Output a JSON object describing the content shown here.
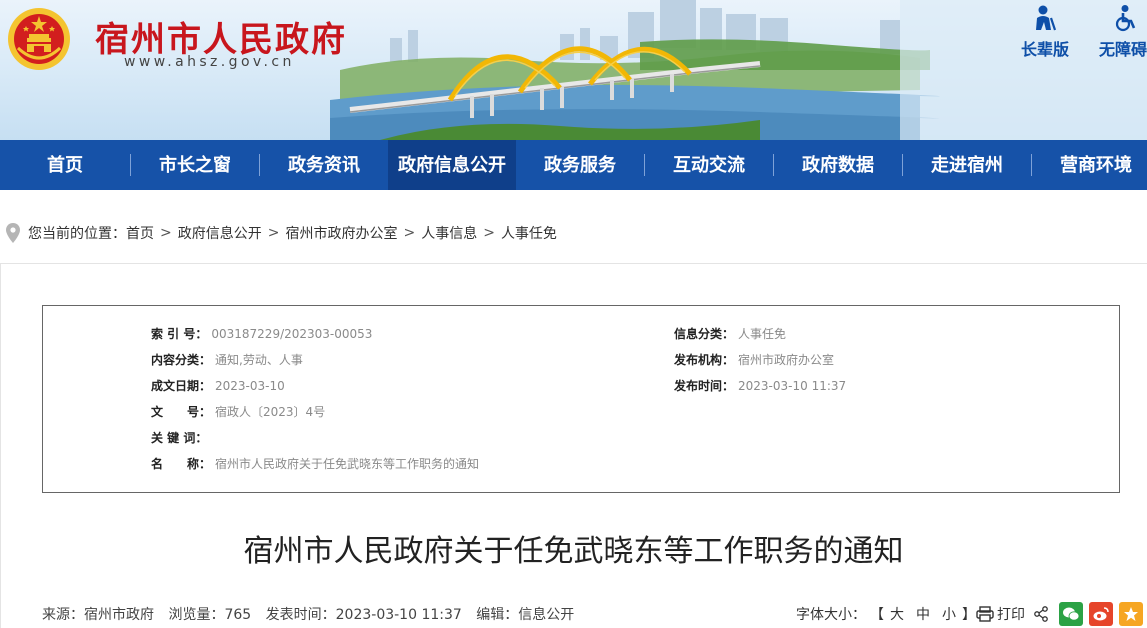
{
  "header": {
    "site_title": "宿州市人民政府",
    "site_url": "www.ahsz.gov.cn",
    "elder_mode": "长辈版",
    "accessibility": "无障碍"
  },
  "nav": {
    "items": [
      {
        "label": "首页"
      },
      {
        "label": "市长之窗"
      },
      {
        "label": "政务资讯"
      },
      {
        "label": "政府信息公开",
        "active": true
      },
      {
        "label": "政务服务"
      },
      {
        "label": "互动交流"
      },
      {
        "label": "政府数据"
      },
      {
        "label": "走进宿州"
      },
      {
        "label": "营商环境"
      }
    ]
  },
  "breadcrumb": {
    "prefix": "您当前的位置：",
    "items": [
      "首页",
      "政府信息公开",
      "宿州市政府办公室",
      "人事信息",
      "人事任免"
    ],
    "separator": ">"
  },
  "meta": {
    "index_label": "索 引 号：",
    "index_value": "003187229/202303-00053",
    "content_cat_label": "内容分类：",
    "content_cat_value": "通知,劳动、人事",
    "created_label": "成文日期：",
    "created_value": "2023-03-10",
    "doc_no_label": "文　　号：",
    "doc_no_value": "宿政人〔2023〕4号",
    "keywords_label": "关 键 词：",
    "keywords_value": "",
    "name_label": "名　　称：",
    "name_value": "宿州市人民政府关于任免武晓东等工作职务的通知",
    "info_cat_label": "信息分类：",
    "info_cat_value": "人事任免",
    "publisher_label": "发布机构：",
    "publisher_value": "宿州市政府办公室",
    "pub_time_label": "发布时间：",
    "pub_time_value": "2023-03-10 11:37"
  },
  "article": {
    "title": "宿州市人民政府关于任免武晓东等工作职务的通知",
    "source": "来源：宿州市政府",
    "views": "浏览量：765",
    "publish_time": "发表时间：2023-03-10 11:37",
    "editor": "编辑：信息公开"
  },
  "tools": {
    "font_size_label": "字体大小：",
    "bracket_open": "【",
    "bracket_close": "】",
    "size_large": "大",
    "size_medium": "中",
    "size_small": "小",
    "print": "打印"
  },
  "colors": {
    "brand_red": "#c8161d",
    "nav_blue": "#1652a8",
    "nav_active": "#0f3f8a",
    "wechat": "#2ba245",
    "weibo": "#e6452a",
    "favorite": "#f6a623"
  }
}
